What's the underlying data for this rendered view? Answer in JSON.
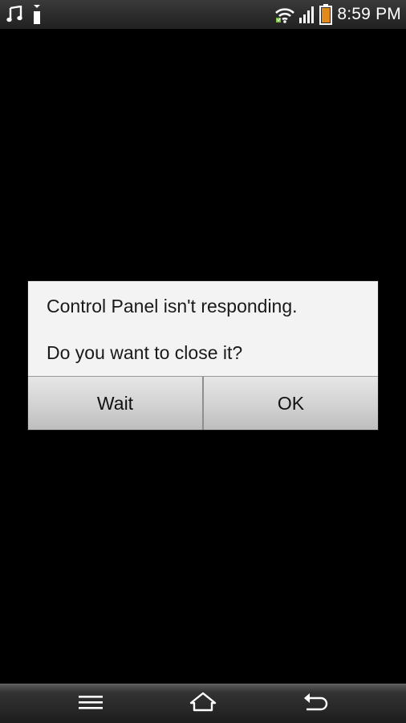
{
  "status_bar": {
    "time": "8:59 PM",
    "icons": [
      "music-note-icon",
      "usb-icon",
      "wifi-icon",
      "signal-icon",
      "battery-icon"
    ]
  },
  "dialog": {
    "message": "Control Panel isn't responding.",
    "question": "Do you want to close it?",
    "wait_label": "Wait",
    "ok_label": "OK"
  },
  "nav_bar": {
    "icons": [
      "menu-icon",
      "home-icon",
      "back-icon"
    ]
  },
  "colors": {
    "background": "#000000",
    "dialog_bg": "#f3f3f3",
    "battery_fill": "#e08a1e",
    "wifi_accent": "#7ac142"
  }
}
